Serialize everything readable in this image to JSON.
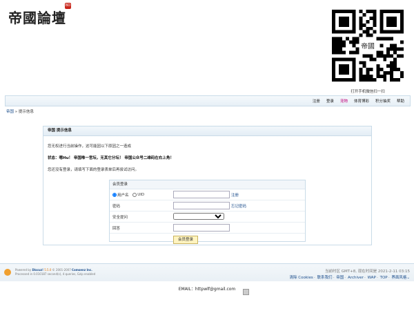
{
  "logo": {
    "text": "帝國論壇",
    "badge": "BD"
  },
  "qr": {
    "caption": "打开手机微信扫一扫",
    "center_text": "帝國"
  },
  "nav": {
    "items": [
      {
        "label": "注册",
        "highlight": false
      },
      {
        "label": "登录",
        "highlight": false
      },
      {
        "label": "宠物",
        "highlight": true
      },
      {
        "label": "体育博彩",
        "highlight": false
      },
      {
        "label": "积分抽奖",
        "highlight": false
      },
      {
        "label": "帮助",
        "highlight": false
      }
    ]
  },
  "breadcrumb": {
    "home": "帝国",
    "sep": "»",
    "current": "提示信息"
  },
  "message": {
    "title": "帝国 提示信息",
    "line1": "您无权进行当前操作，这可能因以下原因之一造成",
    "line2": "状态：嗯Hu！ 帝国唯一官坛，无其它分坛！ 帝国公众号二维码在右上角！",
    "line3": "您还没有登录，请填写下面的登录表单后再尝试访问。"
  },
  "login": {
    "title": "会员登录",
    "radio_username": "用户名",
    "radio_uid": "UID",
    "register_link": "注册",
    "password_label": "密码",
    "forgot_link": "忘记密码",
    "question_label": "安全提问",
    "answer_label": "回答",
    "submit": "会员登录"
  },
  "footer": {
    "powered": "Powered by",
    "brand": "Discuz!",
    "version": "5.5.0",
    "copyright": "© 2001-2007",
    "company": "Comsenz Inc.",
    "processed": "Processed in 0.010187 second(s), 4 queries, Gzip enabled",
    "timezone": "当前时区 GMT+8, 现在时间是 2021-2-11 03:15",
    "links": [
      "清除 Cookies",
      "联系我们",
      "帝国",
      "Archiver",
      "WAP",
      "TOP",
      "界面风格"
    ],
    "email": "EMAIL：httpwlf@gmail.com"
  },
  "colors": {
    "accent": "#1a4c8b",
    "highlight": "#c0007a",
    "border": "#c9dbe8"
  }
}
